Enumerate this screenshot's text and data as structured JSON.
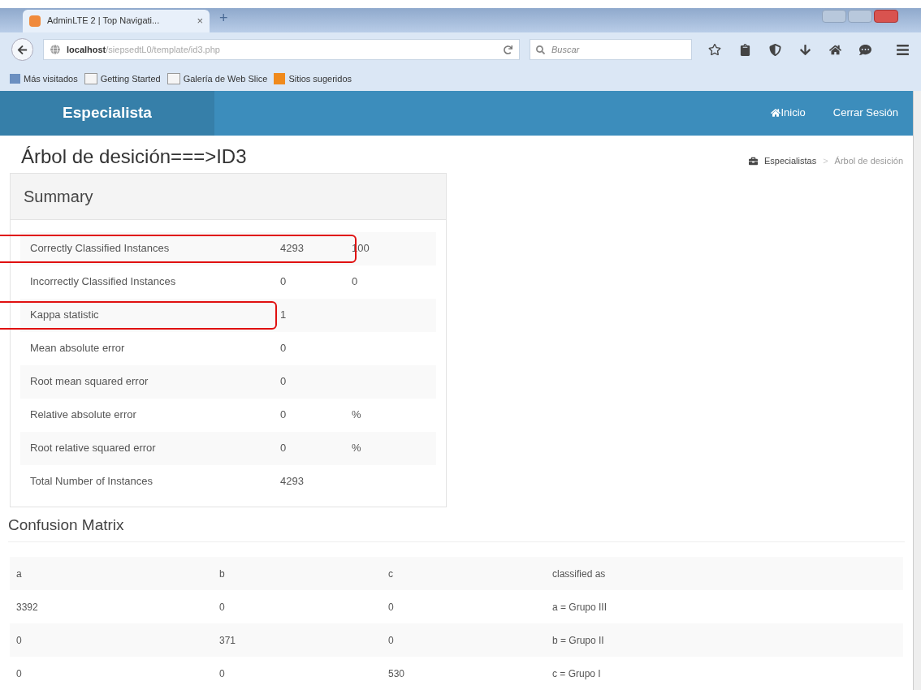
{
  "browser": {
    "tab_title": "AdminLTE 2 | Top Navigati...",
    "tab_close": "×",
    "new_tab": "+",
    "url_host": "localhost",
    "url_path": "/siepsedtL0/template/id3.php",
    "search_placeholder": "Buscar",
    "bookmarks": [
      "Más visitados",
      "Getting Started",
      "Galería de Web Slice",
      "Sitios sugeridos"
    ]
  },
  "navbar": {
    "brand": "Especialista",
    "links": [
      {
        "label": "Inicio",
        "kind": "home"
      },
      {
        "label": "Cerrar Sesión",
        "kind": "plain"
      }
    ]
  },
  "page_title": "Árbol de desición===>ID3",
  "breadcrumb": [
    "Especialistas",
    ">",
    "Árbol de desición"
  ],
  "summary": {
    "title": "Summary",
    "rows": [
      {
        "label": "Correctly Classified Instances",
        "value": "4293",
        "extra": "100",
        "highlighted": true
      },
      {
        "label": "Incorrectly Classified Instances",
        "value": "0",
        "extra": "0",
        "highlighted": false
      },
      {
        "label": "Kappa statistic",
        "value": "1",
        "highlighted": true
      },
      {
        "label": "Mean absolute error",
        "value": "0",
        "highlighted": false
      },
      {
        "label": "Root mean squared error",
        "value": "0",
        "highlighted": false
      },
      {
        "label": "Relative absolute error",
        "value": "0",
        "extra": "%",
        "highlighted": false
      },
      {
        "label": "Root relative squared error",
        "value": "0",
        "extra": "%",
        "highlighted": false
      },
      {
        "label": "Total Number of Instances",
        "value": "4293",
        "highlighted": false
      }
    ]
  },
  "confusion_matrix": {
    "title": "Confusion Matrix",
    "columns": [
      "a",
      "b",
      "c",
      "classified as"
    ],
    "rows": [
      [
        "3392",
        "0",
        "0",
        "a = Grupo III"
      ],
      [
        "0",
        "371",
        "0",
        "b = Grupo II"
      ],
      [
        "0",
        "0",
        "530",
        "c = Grupo I"
      ]
    ]
  }
}
